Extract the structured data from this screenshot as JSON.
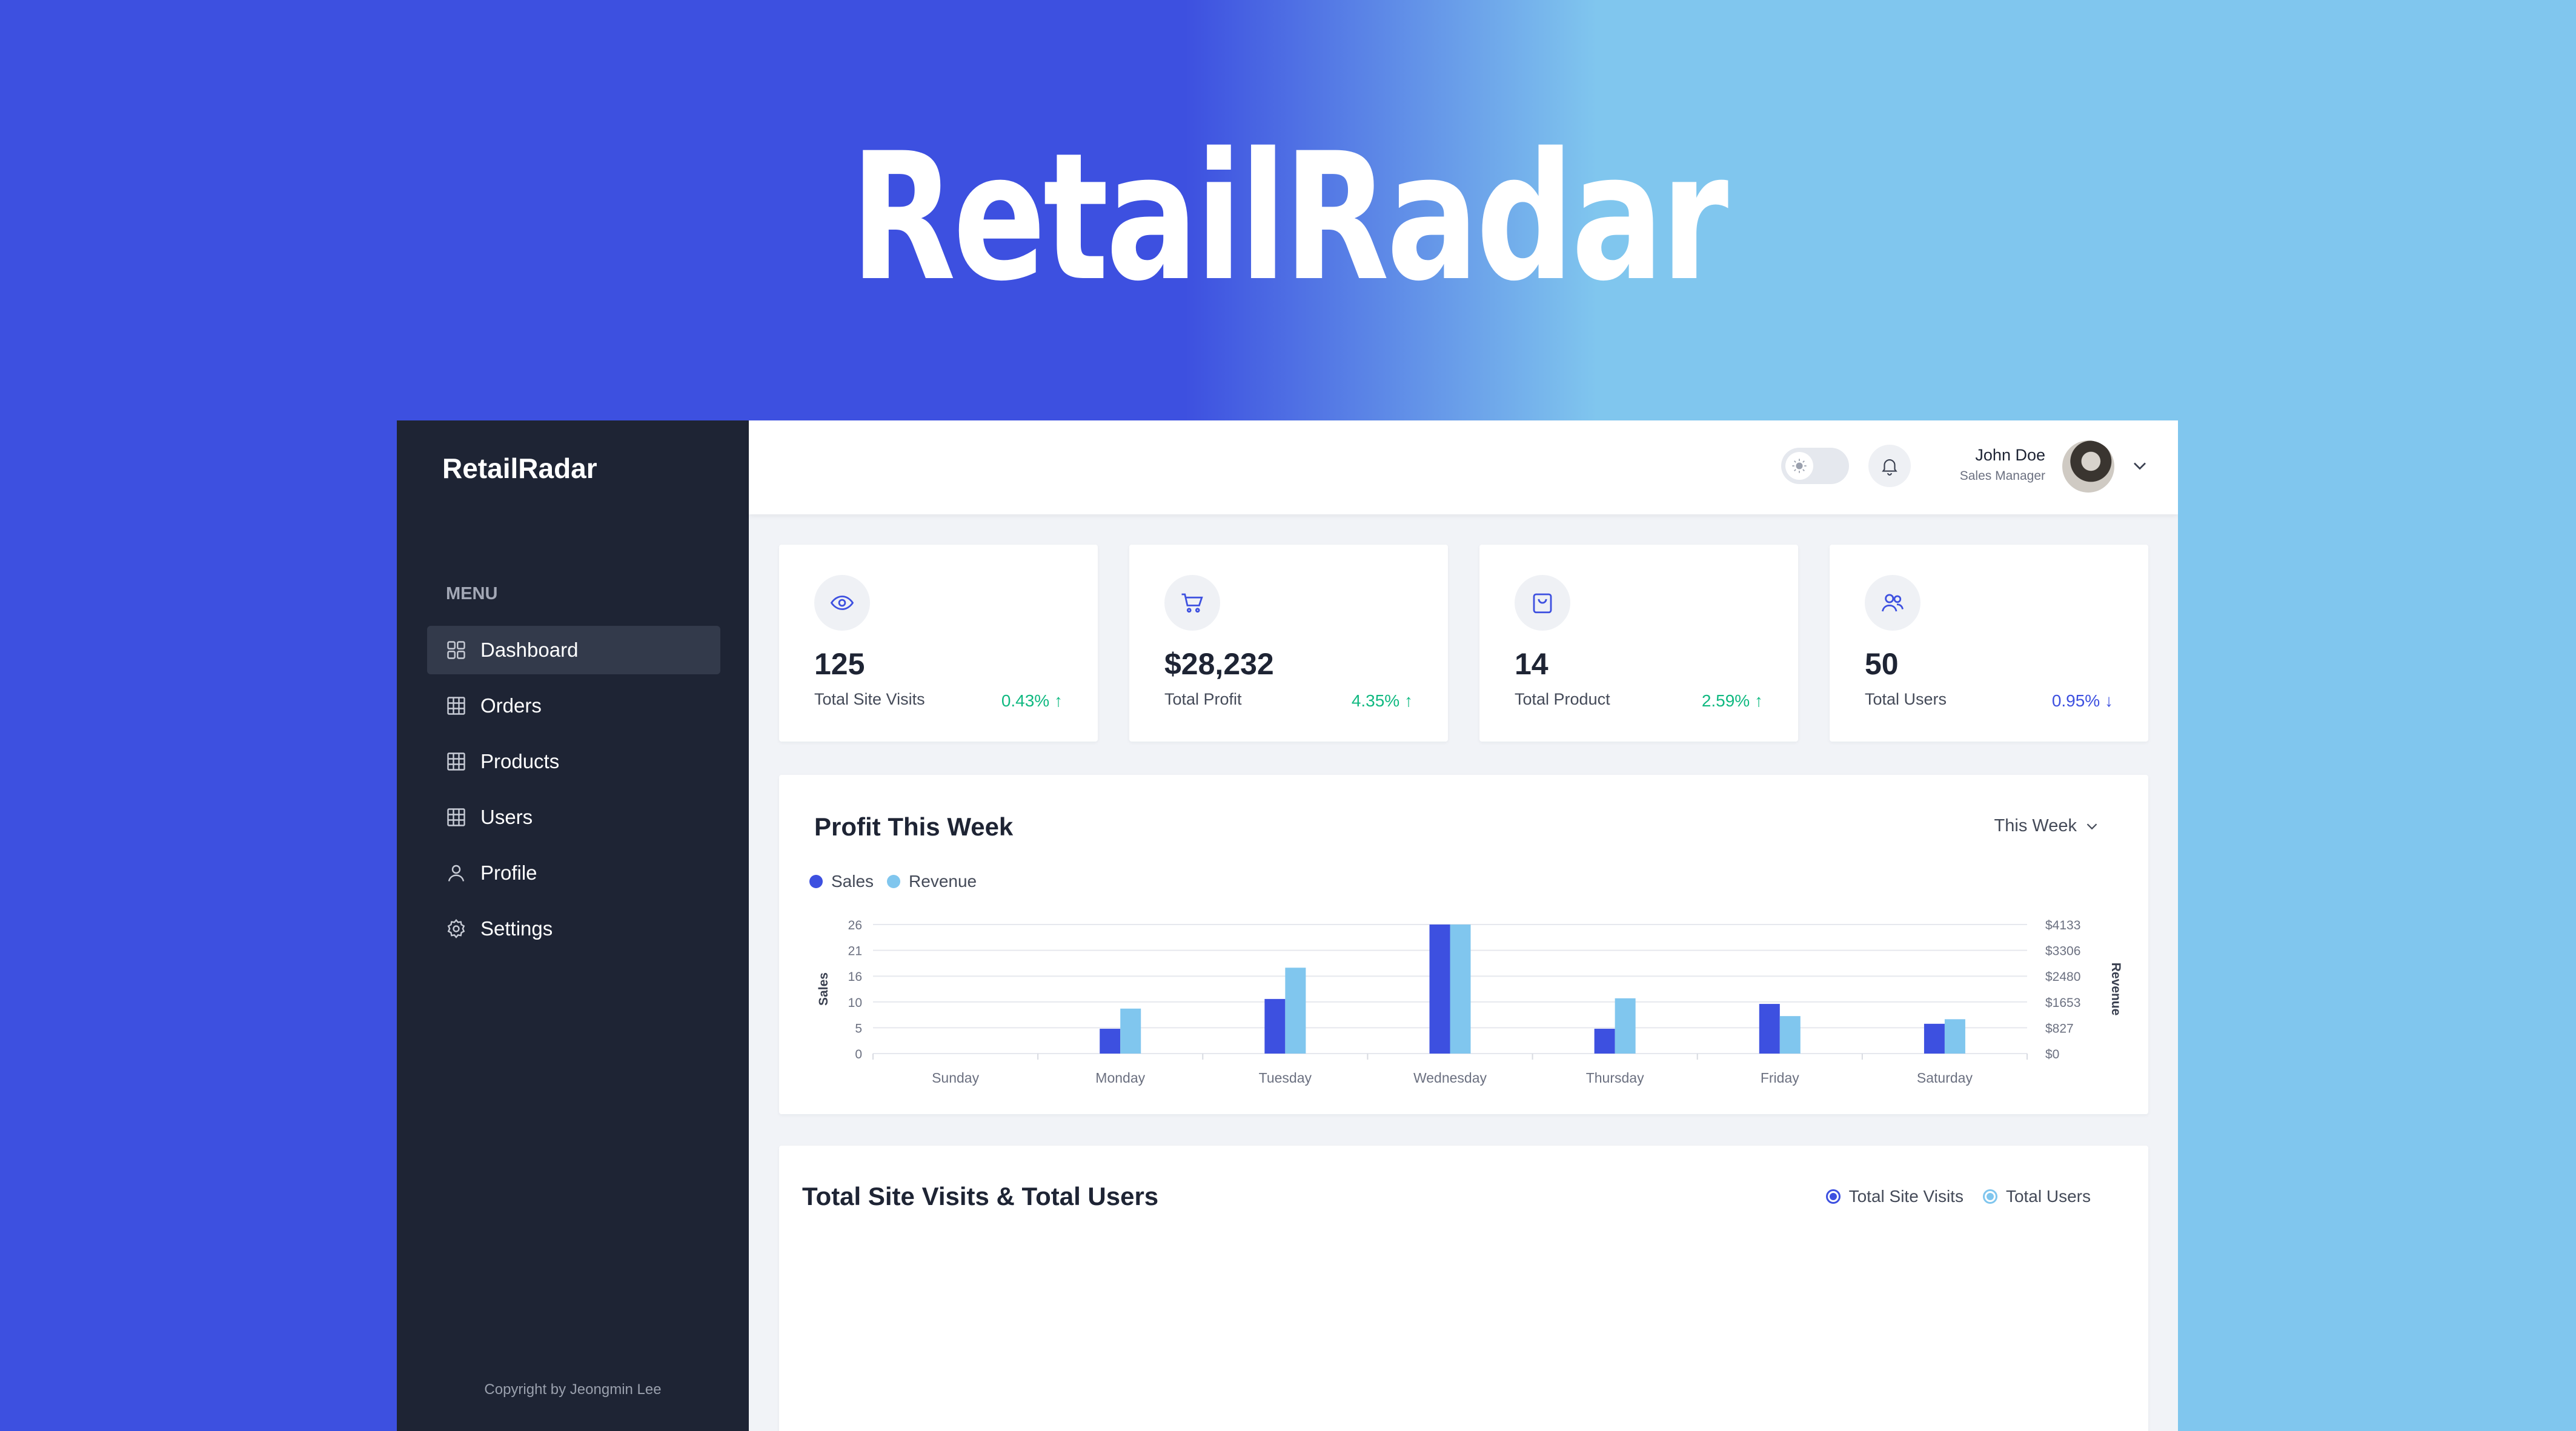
{
  "hero": {
    "title": "RetailRadar"
  },
  "sidebar": {
    "brand": "RetailRadar",
    "menu_label": "MENU",
    "items": [
      {
        "label": "Dashboard",
        "icon": "dashboard-grid-icon",
        "active": true
      },
      {
        "label": "Orders",
        "icon": "table-icon"
      },
      {
        "label": "Products",
        "icon": "table-icon"
      },
      {
        "label": "Users",
        "icon": "table-icon"
      },
      {
        "label": "Profile",
        "icon": "user-icon"
      },
      {
        "label": "Settings",
        "icon": "gear-icon"
      }
    ],
    "copyright": "Copyright by Jeongmin Lee"
  },
  "header": {
    "user_name": "John Doe",
    "user_role": "Sales Manager"
  },
  "stats": [
    {
      "value": "125",
      "label": "Total Site Visits",
      "change": "0.43%",
      "direction": "up",
      "icon": "eye-icon"
    },
    {
      "value": "$28,232",
      "label": "Total Profit",
      "change": "4.35%",
      "direction": "up",
      "icon": "cart-icon"
    },
    {
      "value": "14",
      "label": "Total Product",
      "change": "2.59%",
      "direction": "up",
      "icon": "bag-icon"
    },
    {
      "value": "50",
      "label": "Total Users",
      "change": "0.95%",
      "direction": "down",
      "icon": "users-icon"
    }
  ],
  "profit_chart": {
    "title": "Profit This Week",
    "period": "This Week"
  },
  "visits_chart": {
    "title": "Total Site Visits & Total Users",
    "legend": [
      "Total Site Visits",
      "Total Users"
    ]
  },
  "colors": {
    "accent": "#3d50e0",
    "light_accent": "#80c6ee",
    "positive": "#10b981",
    "negative": "#3d50e0"
  },
  "chart_data": {
    "type": "bar",
    "title": "Profit This Week",
    "categories": [
      "Sunday",
      "Monday",
      "Tuesday",
      "Wednesday",
      "Thursday",
      "Friday",
      "Saturday"
    ],
    "series": [
      {
        "name": "Sales",
        "axis": "left",
        "color": "#3d50e0",
        "values": [
          0,
          5,
          11,
          26,
          5,
          10,
          6
        ]
      },
      {
        "name": "Revenue",
        "axis": "right",
        "color": "#80c6ee",
        "values": [
          0,
          1440,
          2750,
          4133,
          1770,
          1200,
          1100
        ]
      }
    ],
    "ylabel": "Sales",
    "y2label": "Revenue",
    "ylim": [
      0,
      26
    ],
    "y2lim": [
      0,
      4133
    ],
    "yticks": [
      "0",
      "5",
      "10",
      "16",
      "21",
      "26"
    ],
    "y2ticks": [
      "$0",
      "$827",
      "$1653",
      "$2480",
      "$3306",
      "$4133"
    ],
    "grid": true,
    "legend": "top-left"
  }
}
